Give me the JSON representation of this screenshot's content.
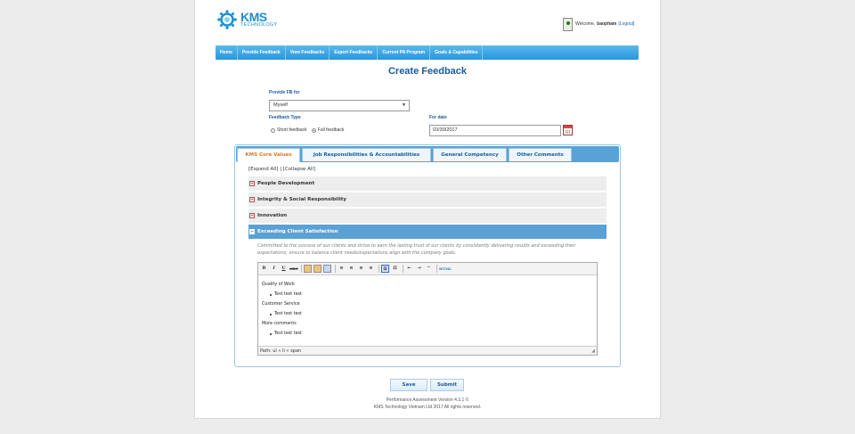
{
  "header": {
    "logo_text": "KMS",
    "logo_sub": "TECHNOLOGY",
    "welcome_prefix": "Welcome,",
    "username": "baopham",
    "logout_label": "[Logout]"
  },
  "nav": {
    "items": [
      {
        "label": "Home"
      },
      {
        "label": "Provide Feedback"
      },
      {
        "label": "View Feedbacks"
      },
      {
        "label": "Export Feedbacks"
      },
      {
        "label": "Current PA Program"
      },
      {
        "label": "Goals & Capabilities"
      }
    ]
  },
  "page_title": "Create Feedback",
  "form": {
    "provide_for_label": "Provide FB for",
    "provide_for_value": "Myself",
    "feedback_type_label": "Feedback Type",
    "short_feedback_label": "Short feedback",
    "full_feedback_label": "Full feedback",
    "full_selected": true,
    "for_date_label": "For date",
    "for_date_value": "03/30/2017"
  },
  "tabs": [
    {
      "label": "KMS Core Values",
      "active": true
    },
    {
      "label": "Job Responsibilities & Accountabilities"
    },
    {
      "label": "General Competency"
    },
    {
      "label": "Other Comments"
    }
  ],
  "expand_all": "[Expand All]",
  "separator": "|",
  "collapse_all": "[Collapse All]",
  "sections": [
    {
      "label": "People Development",
      "open": false
    },
    {
      "label": "Integrity & Social Responsibility",
      "open": false
    },
    {
      "label": "Innovation",
      "open": false
    },
    {
      "label": "Exceeding Client Satisfaction",
      "open": true
    }
  ],
  "open_section_description": "Committed to the success of our clients and strive to earn the lasting trust of our clients by consistently delivering results and exceeding their expectations; ensure to balance client needs/expectations align with the company goals.",
  "editor": {
    "content": [
      {
        "type": "p",
        "text": "Quality of Work"
      },
      {
        "type": "li",
        "text": "Test test test"
      },
      {
        "type": "p",
        "text": "Customer Service"
      },
      {
        "type": "li",
        "text": "Test test test"
      },
      {
        "type": "p",
        "text": "More comments"
      },
      {
        "type": "li",
        "text": "Test test test"
      }
    ],
    "path": "Path: ul » li » span"
  },
  "buttons": {
    "save": "Save",
    "submit": "Submit"
  },
  "footer": {
    "version": "Performance Assessment Version 4.3.1 ©",
    "copyright": "KMS Technology Vietnam Ltd 2017 All rights reserved."
  },
  "colors": {
    "brand": "#1b8fd0",
    "nav": "#2b96d9",
    "title": "#1b5a9c",
    "active_tab": "#e07a12"
  }
}
